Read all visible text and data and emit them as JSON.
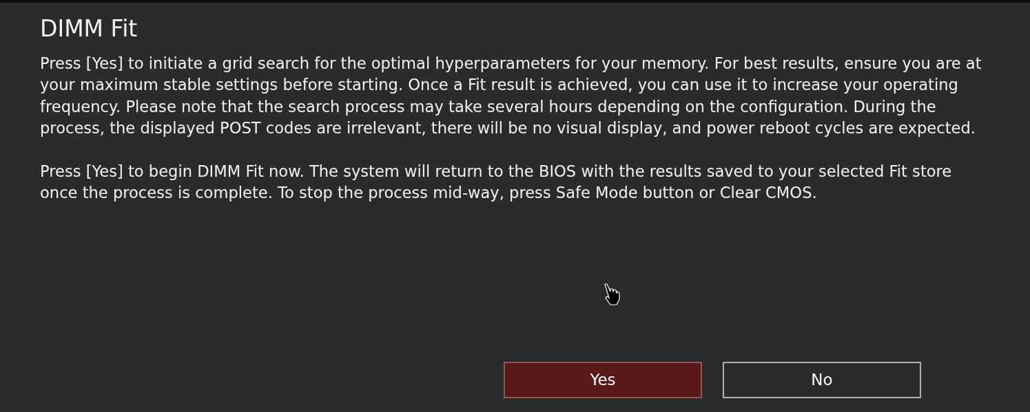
{
  "dialog": {
    "title": "DIMM Fit",
    "paragraphs": [
      "Press [Yes] to initiate a grid search for the optimal hyperparameters for your memory. For best results, ensure you are at your maximum stable settings before starting. Once a Fit result is achieved, you can use it to increase your operating frequency. Please note that the search process may take several hours depending on the configuration. During the process, the displayed POST codes are irrelevant, there will be no visual display, and power reboot cycles are expected.",
      "Press [Yes] to begin DIMM Fit now. The system will return to the BIOS with the results saved to your selected Fit store once the process is complete. To stop the process mid-way, press Safe Mode button or Clear CMOS."
    ],
    "buttons": [
      {
        "label": "Yes",
        "selected": true
      },
      {
        "label": "No",
        "selected": false
      }
    ]
  }
}
